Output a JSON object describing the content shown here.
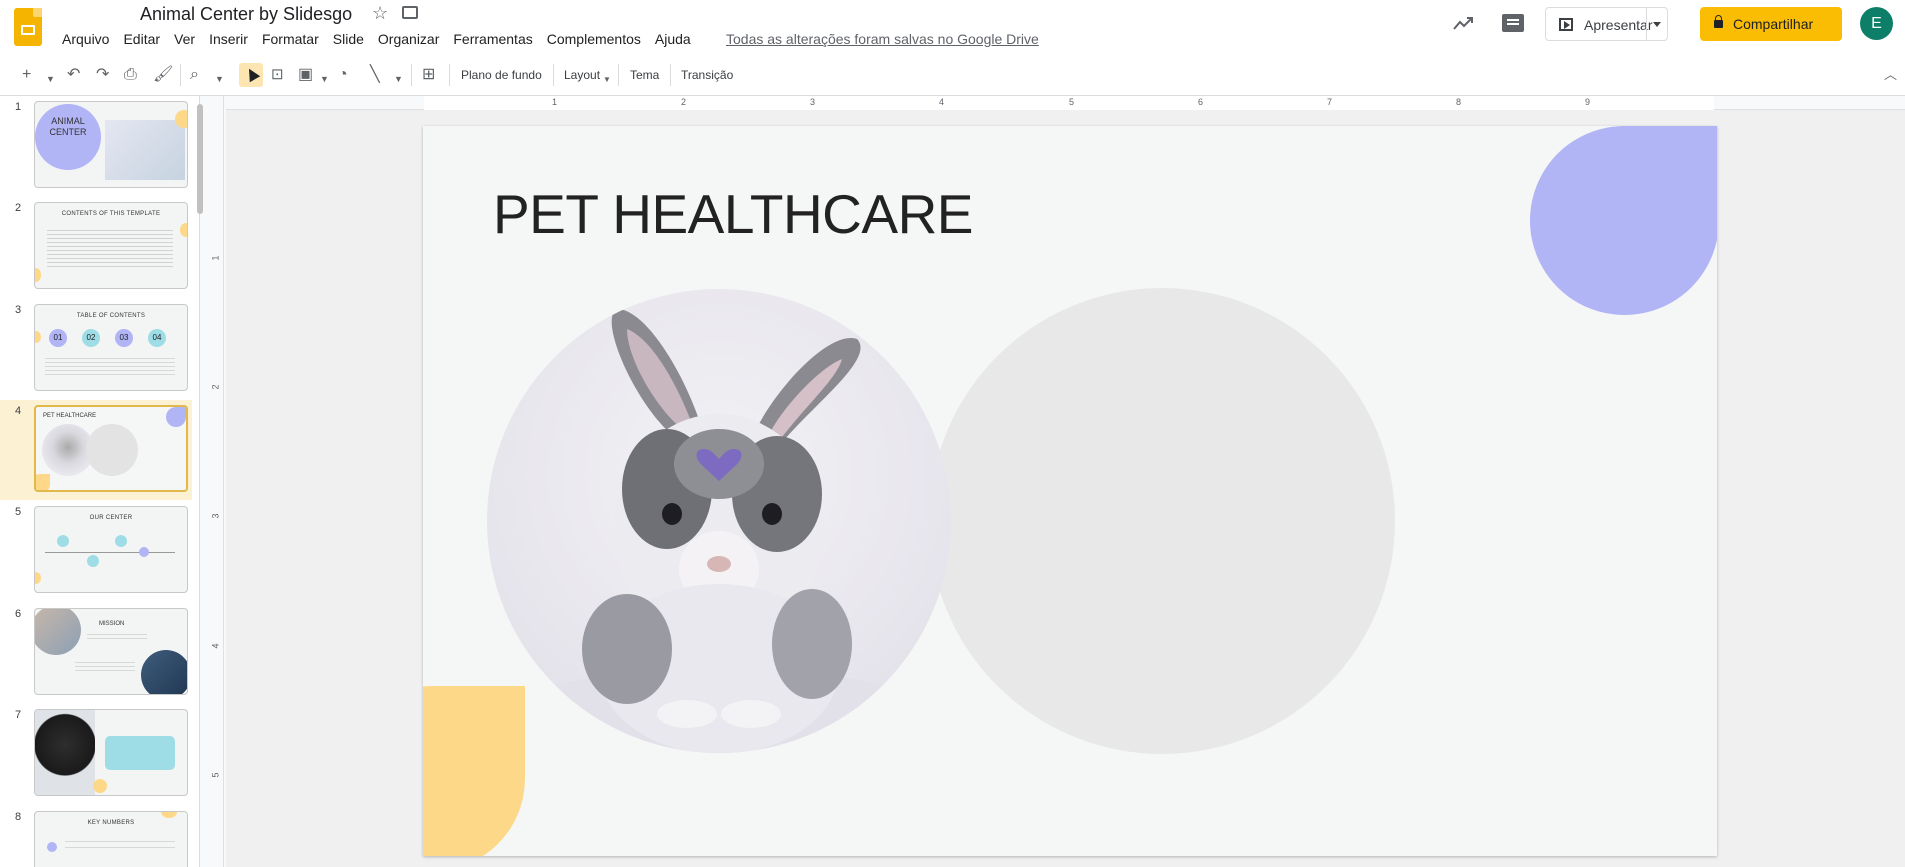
{
  "app": {
    "title": "Animal Center by Slidesgo",
    "save_status": "Todas as alterações foram salvas no Google Drive",
    "avatar_letter": "E"
  },
  "menu": [
    "Arquivo",
    "Editar",
    "Ver",
    "Inserir",
    "Formatar",
    "Slide",
    "Organizar",
    "Ferramentas",
    "Complementos",
    "Ajuda"
  ],
  "header_buttons": {
    "present": "Apresentar",
    "share": "Compartilhar"
  },
  "toolbar": {
    "background": "Plano de fundo",
    "layout": "Layout",
    "theme": "Tema",
    "transition": "Transição"
  },
  "ruler": {
    "horizontal": [
      "1",
      "2",
      "3",
      "4",
      "5",
      "6",
      "7",
      "8",
      "9"
    ],
    "vertical": [
      "1",
      "2",
      "3",
      "4",
      "5"
    ]
  },
  "filmstrip": {
    "slides": [
      {
        "num": "1",
        "title": "ANIMAL CENTER"
      },
      {
        "num": "2",
        "title": "CONTENTS OF THIS TEMPLATE"
      },
      {
        "num": "3",
        "title": "TABLE OF CONTENTS"
      },
      {
        "num": "4",
        "title": "PET HEALTHCARE"
      },
      {
        "num": "5",
        "title": "OUR CENTER"
      },
      {
        "num": "6",
        "title": "MISSION"
      },
      {
        "num": "7",
        "title": ""
      },
      {
        "num": "8",
        "title": "KEY NUMBERS"
      }
    ],
    "toc_numbers": [
      "01",
      "02",
      "03",
      "04"
    ]
  },
  "slide": {
    "title": "PET HEALTHCARE"
  },
  "colors": {
    "accent_yellow": "#fbbc04",
    "slide_purple": "#b1b4f5",
    "slide_yellow": "#fdd888",
    "avatar_green": "#0d7e68"
  }
}
